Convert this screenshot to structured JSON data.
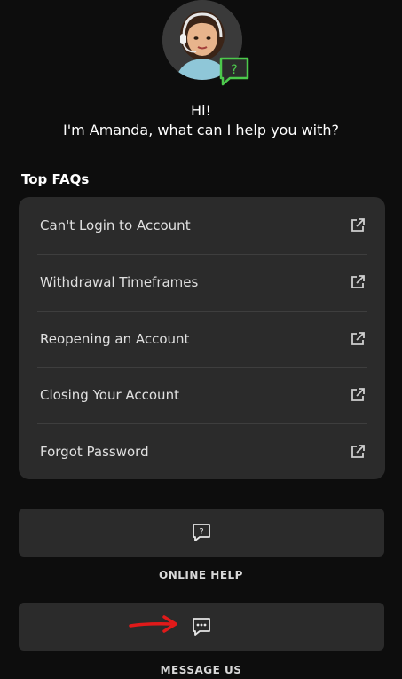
{
  "assistant": {
    "greeting_line1": "Hi!",
    "greeting_line2": "I'm Amanda, what can I help you with?",
    "badge_glyph": "?"
  },
  "faq": {
    "title": "Top FAQs",
    "items": [
      {
        "label": "Can't Login to Account",
        "icon": "external-link-icon"
      },
      {
        "label": "Withdrawal Timeframes",
        "icon": "external-link-icon"
      },
      {
        "label": "Reopening an Account",
        "icon": "external-link-icon"
      },
      {
        "label": "Closing Your Account",
        "icon": "external-link-icon"
      },
      {
        "label": "Forgot Password",
        "icon": "external-link-icon"
      }
    ]
  },
  "actions": {
    "online_help": {
      "label": "ONLINE HELP",
      "icon": "help-chat-icon",
      "icon_glyph": "?"
    },
    "message_us": {
      "label": "MESSAGE US",
      "icon": "message-dots-icon"
    }
  },
  "colors": {
    "background": "#0d0d0d",
    "card": "#2b2b2b",
    "accent_green": "#4cc94c",
    "annotation_red": "#e01a1a"
  }
}
